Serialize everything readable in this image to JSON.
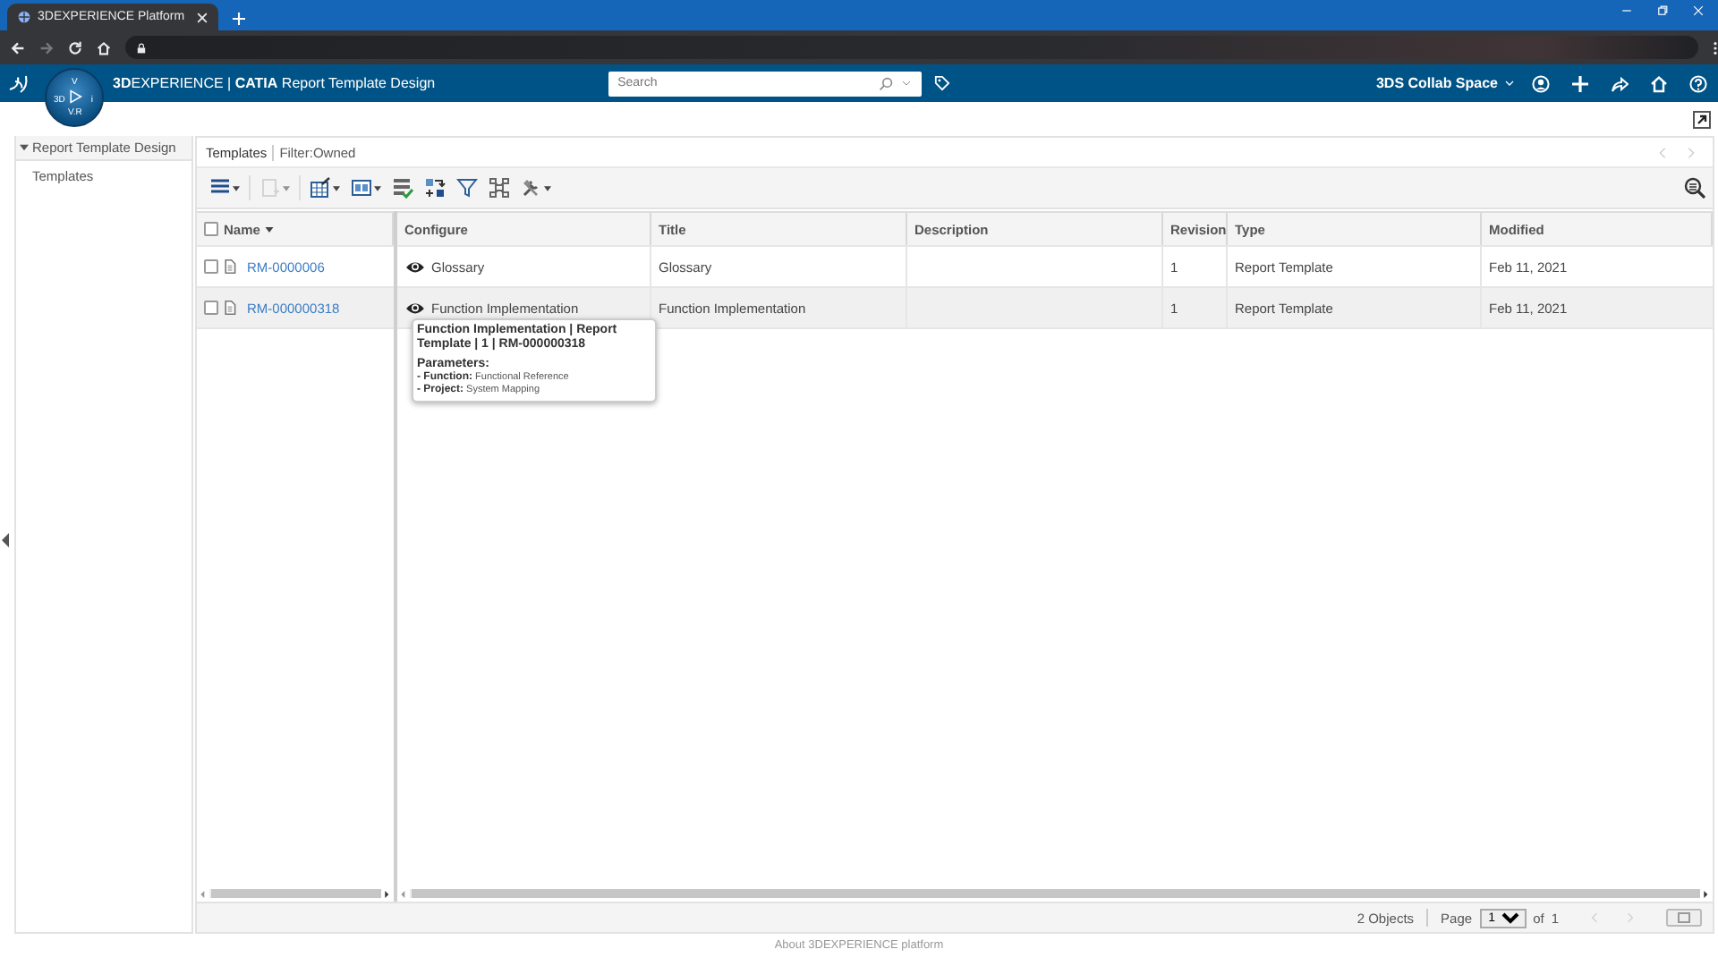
{
  "browser": {
    "tab_title": "3DEXPERIENCE Platform"
  },
  "header": {
    "title": "**3D**EXPERIENCE | **CATIA** Report Template Design",
    "search": {
      "placeholder": "Search"
    },
    "space": "3DS Collab Space"
  },
  "compass": {
    "top": "V",
    "left": "3D",
    "right": "i",
    "bottom": "V.R"
  },
  "sidebar": {
    "items": [
      {
        "label": "Report Template Design",
        "expanded": true,
        "children": [
          {
            "label": "Templates"
          }
        ]
      }
    ]
  },
  "panel": {
    "title": "Templates",
    "filter": "Filter:Owned"
  },
  "toolbar": [
    {
      "kind": "menu",
      "dropdown": true,
      "disabled": false
    },
    {
      "kind": "new",
      "dropdown": true,
      "disabled": true
    },
    {
      "kind": "edit",
      "dropdown": true,
      "disabled": false
    },
    {
      "kind": "columns",
      "dropdown": true,
      "disabled": false
    },
    {
      "kind": "check",
      "dropdown": false,
      "disabled": false
    },
    {
      "kind": "import",
      "dropdown": false,
      "disabled": false
    },
    {
      "kind": "filter",
      "dropdown": false,
      "disabled": false
    },
    {
      "kind": "tree",
      "dropdown": false,
      "disabled": false
    },
    {
      "kind": "tools",
      "dropdown": true,
      "disabled": false
    }
  ],
  "table": {
    "select_all_checked": false,
    "columns": [
      {
        "label": "Name",
        "sorted": true
      },
      {
        "label": "Configure",
        "sorted": false
      },
      {
        "label": "Title",
        "sorted": false
      },
      {
        "label": "Description",
        "sorted": false
      },
      {
        "label": "Revision",
        "sorted": false
      },
      {
        "label": "Type",
        "sorted": false
      },
      {
        "label": "Modified",
        "sorted": false
      }
    ],
    "rows": [
      {
        "name": "RM-0000006",
        "configure": "Glossary",
        "title": "Glossary",
        "revision": "1",
        "type": "Report Template",
        "modified": "Feb 11, 2021",
        "checked": false,
        "hovered": false
      },
      {
        "name": "RM-000000318",
        "configure": "Function Implementation",
        "title": "Function Implementation",
        "revision": "1",
        "type": "Report Template",
        "modified": "Feb 11, 2021",
        "checked": false,
        "hovered": true
      }
    ]
  },
  "tooltip": {
    "title": "Function Implementation | Report Template | 1 | RM-000000318",
    "heading": "Parameters:",
    "params": [
      {
        "label": "- Function:",
        "value": "Functional Reference"
      },
      {
        "label": "- Project:",
        "value": "System Mapping"
      }
    ]
  },
  "footer": {
    "count": "2 Objects",
    "page_label": "Page",
    "page": "1",
    "of": "of",
    "pages": "1"
  },
  "about": "About 3DEXPERIENCE platform"
}
